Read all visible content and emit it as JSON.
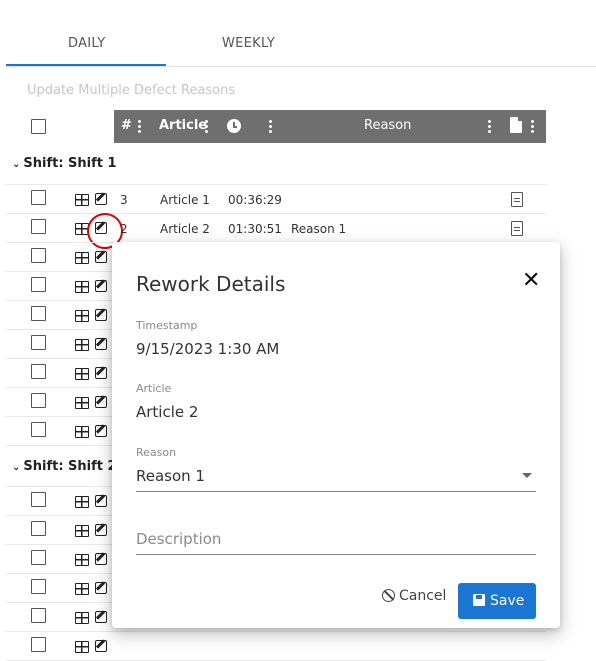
{
  "tabs": [
    {
      "label": "DAILY",
      "active": true
    },
    {
      "label": "WEEKLY",
      "active": false
    }
  ],
  "toolbar": {
    "update_multiple_label": "Update Multiple Defect Reasons"
  },
  "table": {
    "columns": {
      "number": "#",
      "article": "Article",
      "reason": "Reason"
    },
    "groups": [
      {
        "label": "Shift: Shift 1",
        "rows": [
          {
            "number": "3",
            "article": "Article 1",
            "time": "00:36:29",
            "reason": ""
          },
          {
            "number": "2",
            "article": "Article 2",
            "time": "01:30:51",
            "reason": "Reason 1"
          }
        ]
      },
      {
        "label": "Shift: Shift 2",
        "rows": []
      }
    ]
  },
  "dialog": {
    "title": "Rework Details",
    "close_glyph": "✕",
    "timestamp_label": "Timestamp",
    "timestamp_value": "9/15/2023 1:30 AM",
    "article_label": "Article",
    "article_value": "Article 2",
    "reason_label": "Reason",
    "reason_value": "Reason 1",
    "description_placeholder": "Description",
    "cancel_label": "Cancel",
    "save_label": "Save"
  },
  "colors": {
    "accent": "#1976d2",
    "header_bg": "#6f6f6f",
    "highlight": "#e10000"
  }
}
